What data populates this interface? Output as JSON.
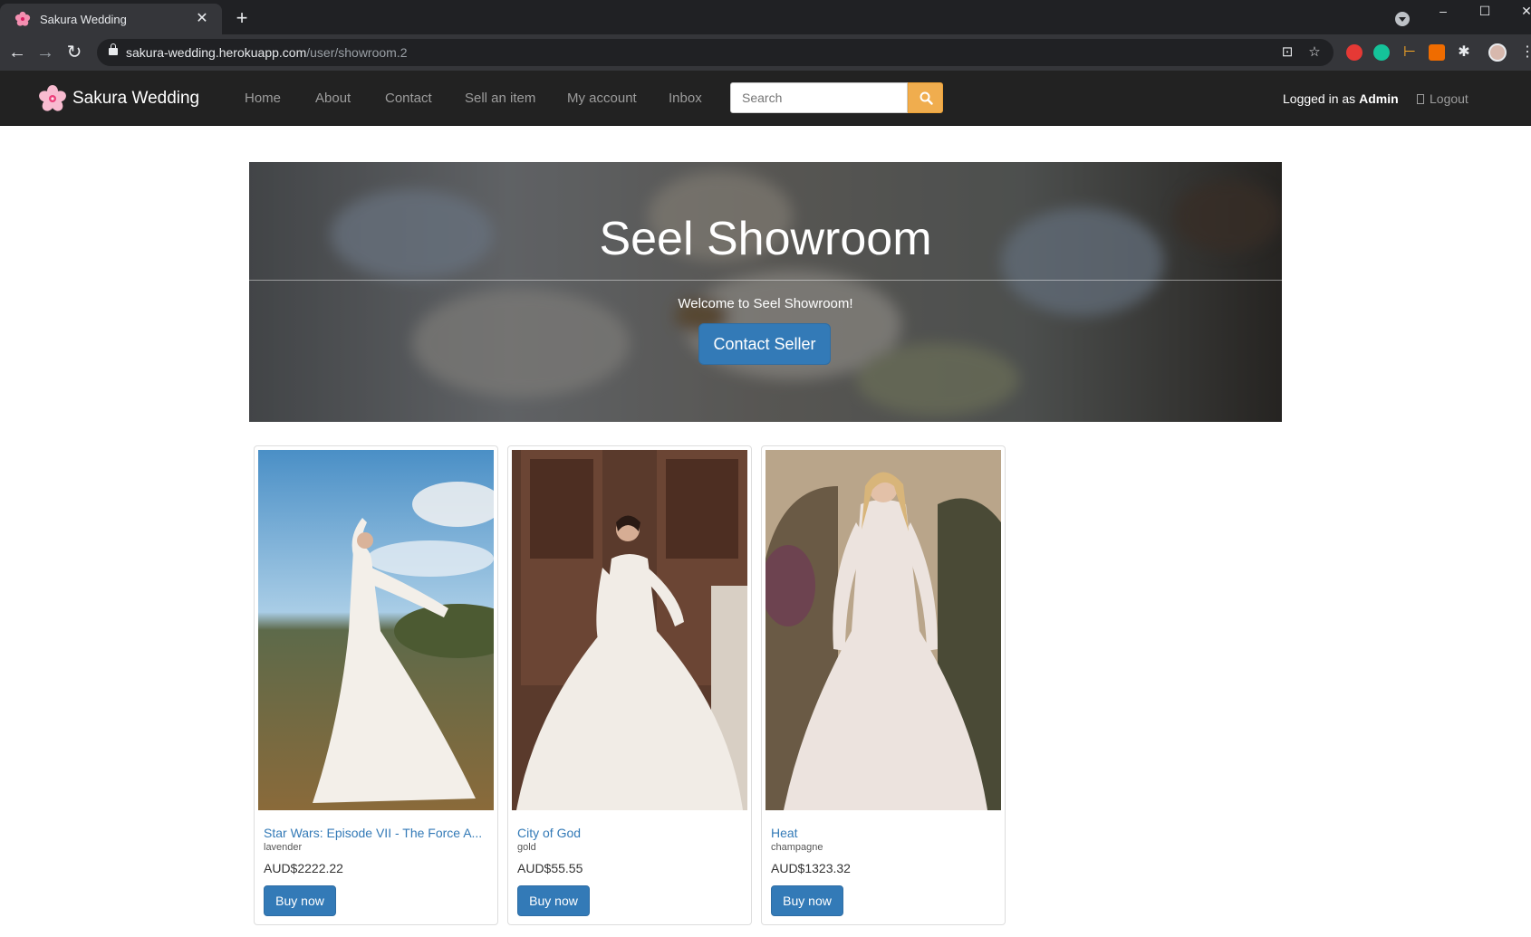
{
  "browser": {
    "tab_title": "Sakura Wedding",
    "tab_close": "✕",
    "new_tab": "+",
    "url_host": "sakura-wedding.herokuapp.com",
    "url_path": "/user/showroom.2",
    "window": {
      "minimize": "–",
      "maximize": "☐",
      "close": "✕"
    }
  },
  "navbar": {
    "brand": "Sakura Wedding",
    "links": [
      "Home",
      "About",
      "Contact",
      "Sell an item",
      "My account",
      "Inbox"
    ],
    "search_placeholder": "Search",
    "logged_prefix": "Logged in as ",
    "logged_user": "Admin",
    "logout": "Logout"
  },
  "jumbotron": {
    "title": "Seel Showroom",
    "subtitle": "Welcome to Seel Showroom!",
    "button": "Contact Seller"
  },
  "products": [
    {
      "title": "Star Wars: Episode VII - The Force A...",
      "color": "lavender",
      "price": "AUD$2222.22",
      "button": "Buy now"
    },
    {
      "title": "City of God",
      "color": "gold",
      "price": "AUD$55.55",
      "button": "Buy now"
    },
    {
      "title": "Heat",
      "color": "champagne",
      "price": "AUD$1323.32",
      "button": "Buy now"
    }
  ],
  "colors": {
    "navbar_bg": "#222222",
    "link_blue": "#337ab7",
    "search_orange": "#f0ad4e",
    "chrome_dark": "#202124"
  }
}
